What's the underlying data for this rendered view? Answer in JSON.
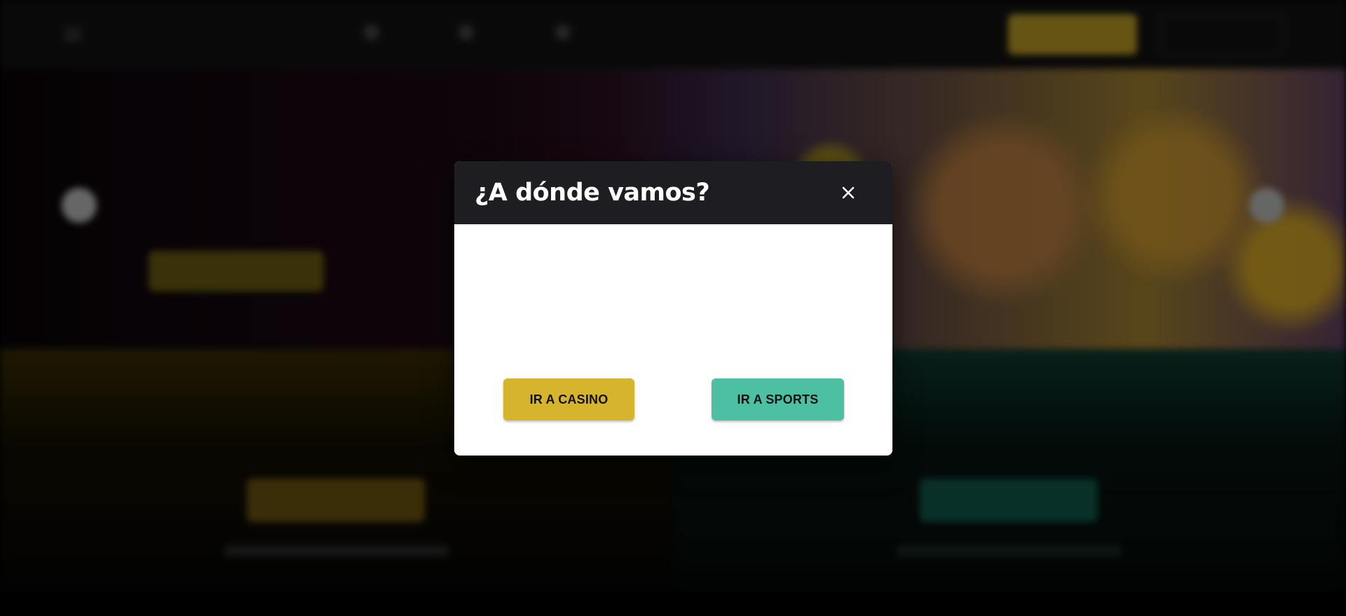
{
  "modal": {
    "title": "¿A dónde vamos?",
    "close_icon": "close-icon",
    "casino_button": "IR A CASINO",
    "sports_button": "IR A SPORTS"
  },
  "colors": {
    "casino_accent": "#d6b42e",
    "sports_accent": "#4dbfa3",
    "modal_header": "#1e1e22"
  },
  "icons": {
    "menu": "hamburger-menu-icon",
    "close": "close-icon",
    "carousel_prev": "chevron-left-icon",
    "carousel_next": "chevron-right-icon"
  }
}
